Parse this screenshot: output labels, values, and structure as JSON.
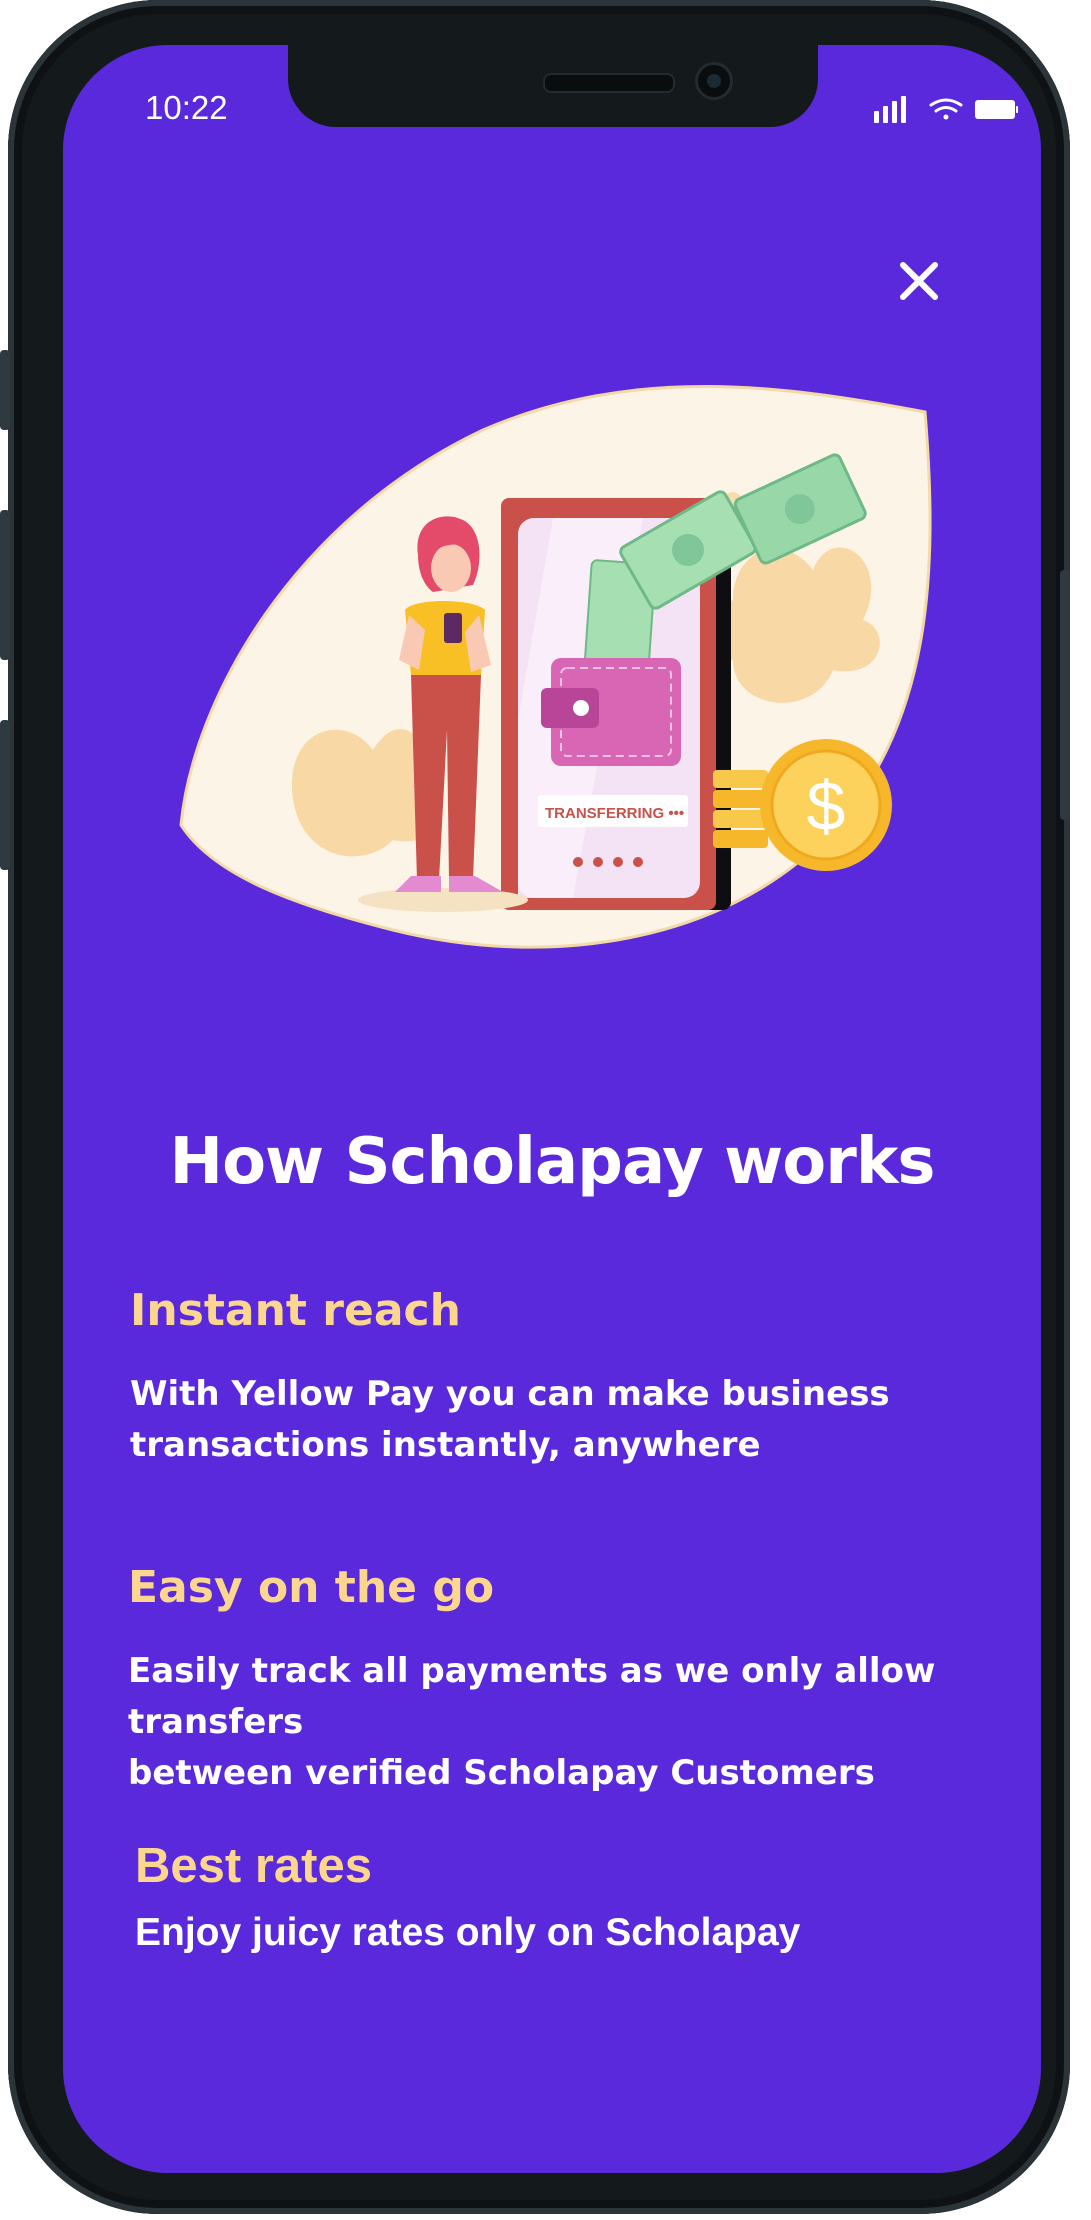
{
  "status_bar": {
    "time": "10:22"
  },
  "illustration": {
    "banner_text": "TRANSFERRING •••",
    "coin_symbol": "$"
  },
  "page": {
    "title": "How Scholapay works"
  },
  "features": [
    {
      "heading": "Instant reach",
      "body_lines": [
        "With Yellow Pay you can make business",
        "transactions instantly, anywhere"
      ]
    },
    {
      "heading": "Easy on the go",
      "body_lines": [
        "Easily track all payments as we only allow transfers",
        "between verified Scholapay Customers"
      ]
    },
    {
      "heading": "Best rates",
      "body_lines": [
        "Enjoy juicy rates only on Scholapay"
      ]
    }
  ],
  "icons": {
    "close": "close-icon",
    "signal": "signal-icon",
    "wifi": "wifi-icon",
    "battery": "battery-icon"
  },
  "colors": {
    "screen_background": "#5a29dc",
    "heading_accent": "#fbd68e",
    "text": "#ffffff",
    "illustration_blob": "#fdf4e8"
  }
}
